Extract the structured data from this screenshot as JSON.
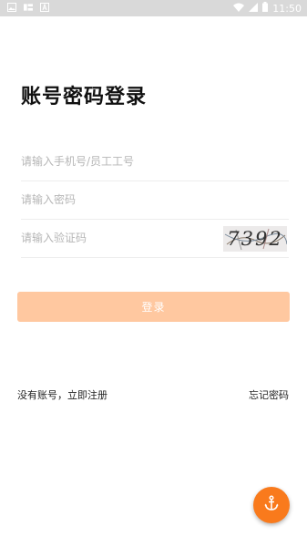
{
  "status_bar": {
    "time": "11:50",
    "left_icons": [
      "image-icon",
      "text-icon",
      "a-icon"
    ],
    "right_icons": [
      "wifi-icon",
      "signal-icon",
      "battery-icon"
    ]
  },
  "page": {
    "title": "账号密码登录"
  },
  "form": {
    "phone_placeholder": "请输入手机号/员工工号",
    "phone_value": "",
    "password_placeholder": "请输入密码",
    "password_value": "",
    "code_placeholder": "请输入验证码",
    "code_value": "",
    "captcha_text": "7392"
  },
  "actions": {
    "login_label": "登录",
    "register_link": "没有账号，立即注册",
    "forgot_link": "忘记密码"
  },
  "colors": {
    "accent": "#f97a1c",
    "button_disabled": "#ffc8a0",
    "status_bar": "#d9d9d9"
  },
  "fab": {
    "icon": "anchor-icon"
  }
}
